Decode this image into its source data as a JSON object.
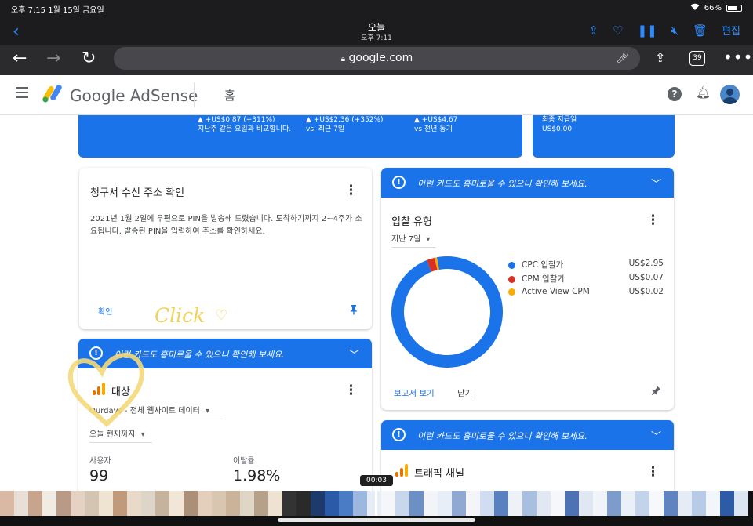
{
  "status": {
    "time_date": "오후 7:15   1월 15일 금요일",
    "wifi": "wifi-icon",
    "battery": "66%"
  },
  "photos": {
    "title": "오늘",
    "subtitle": "오후 7:11",
    "edit": "편집"
  },
  "browser": {
    "url": "google.com",
    "tab_count": "39"
  },
  "header": {
    "brand": "Google AdSense",
    "page": "홈"
  },
  "stats": [
    {
      "change": "▲ +US$0.87 (+311%)",
      "note": "지난주 같은 요일과 비교합니다."
    },
    {
      "change": "▲ +US$2.36 (+352%)",
      "note": "vs. 최근 7일"
    },
    {
      "change": "▲ +US$4.67",
      "note": "vs 전년 동기"
    }
  ],
  "payment": {
    "label": "최종 지급일",
    "value": "US$0.00"
  },
  "address_card": {
    "title": "청구서 수신 주소 확인",
    "body": "2021년 1월 2일에 우편으로 PIN을 발송해 드렸습니다. 도착하기까지 2~4주가 소요됩니다. 발송된 PIN을 입력하여 주소를 확인하세요.",
    "action": "확인"
  },
  "tip_text": "이런 카드도 흥미로울 수 있으니 확인해 보세요.",
  "audience": {
    "title": "대상",
    "site": "Ourdays - 전체 웹사이트 데이터",
    "range": "오늘 현재까지",
    "metrics": [
      {
        "label": "사용자",
        "value": "99"
      },
      {
        "label": "이탈률",
        "value": "1.98%"
      }
    ]
  },
  "bid_card": {
    "title": "입찰 유형",
    "range": "지난 7일",
    "report_link": "보고서 보기",
    "close": "닫기"
  },
  "chart_data": {
    "type": "pie",
    "donut": true,
    "categories": [
      "CPC 입찰가",
      "CPM 입찰가",
      "Active View CPM"
    ],
    "values": [
      2.95,
      0.07,
      0.02
    ],
    "value_labels": [
      "US$2.95",
      "US$0.07",
      "US$0.02"
    ],
    "colors": [
      "#1a73e8",
      "#d93025",
      "#f9ab00"
    ]
  },
  "traffic": {
    "title": "트래픽 채널"
  },
  "annotation": {
    "word": "Click"
  },
  "video": {
    "time": "00:03"
  }
}
